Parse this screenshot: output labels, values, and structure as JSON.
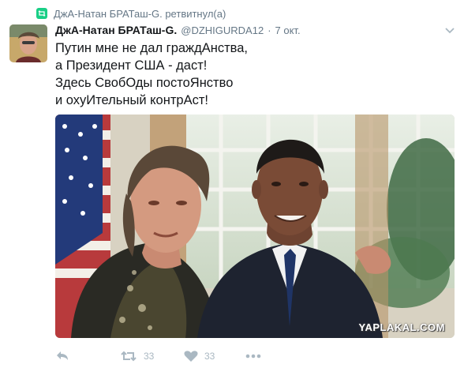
{
  "retweet": {
    "text": "ДжА-Натан БРАТаш-G. ретвитнул(а)",
    "icon": "retweet-icon"
  },
  "tweet": {
    "display_name": "ДжА-Натан БРАТаш-G.",
    "handle": "@DZHIGURDA12",
    "separator": "·",
    "timestamp": "7 окт.",
    "lines": [
      "Путин мне не дал граждАнства,",
      "а Президент США - даст!",
      "Здесь СвобОды постоЯнство",
      "и охуИтельный контрАст!"
    ]
  },
  "media": {
    "watermark": "YAPLAKAL.COM"
  },
  "actions": {
    "reply": {
      "icon": "reply-icon"
    },
    "retweet": {
      "icon": "retweet-icon",
      "count": "33"
    },
    "like": {
      "icon": "heart-icon",
      "count": "33"
    },
    "more": {
      "icon": "more-icon"
    }
  },
  "colors": {
    "retweet_green": "#19cf86",
    "muted": "#657786",
    "icon_gray": "#aab8c2",
    "text": "#14171a"
  }
}
